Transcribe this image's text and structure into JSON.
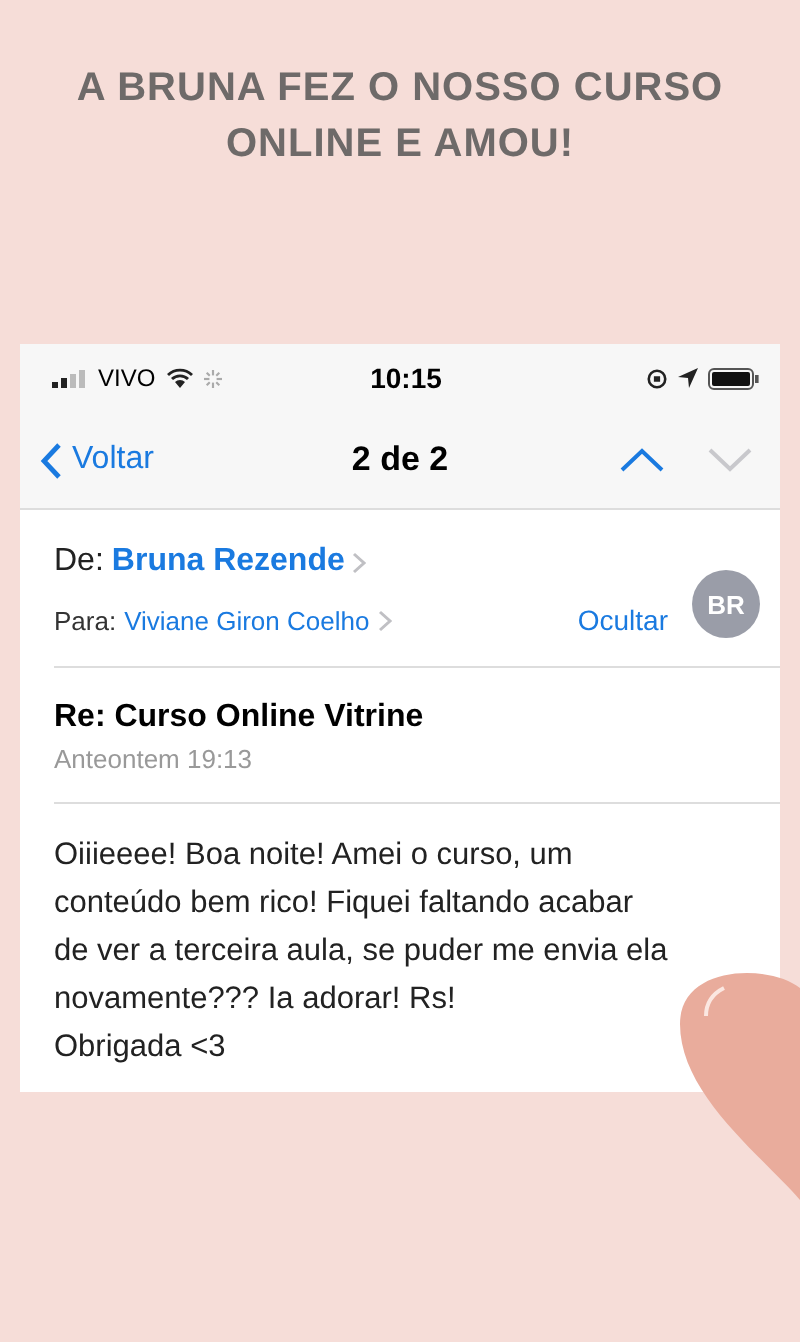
{
  "heading": "A BRUNA FEZ O NOSSO CURSO ONLINE E AMOU!",
  "status_bar": {
    "carrier": "VIVO",
    "time": "10:15"
  },
  "nav": {
    "back": "Voltar",
    "title": "2 de 2",
    "buttons": [
      {
        "kind": "up",
        "disabled": false
      },
      {
        "kind": "down",
        "disabled": true
      }
    ]
  },
  "header": {
    "from_label": "De:",
    "from": "Bruna Rezende",
    "to_label": "Para:",
    "to": "Viviane Giron Coelho",
    "hide": "Ocultar",
    "avatar": "BR"
  },
  "subject": "Re: Curso Online Vitrine",
  "date": "Anteontem 19:13",
  "body": "Oiiieeee! Boa noite! Amei o curso, um\nconteúdo bem rico! Fiquei faltando acabar\nde ver a terceira aula, se puder me envia ela\nnovamente??? Ia adorar! Rs!\nObrigada <3"
}
